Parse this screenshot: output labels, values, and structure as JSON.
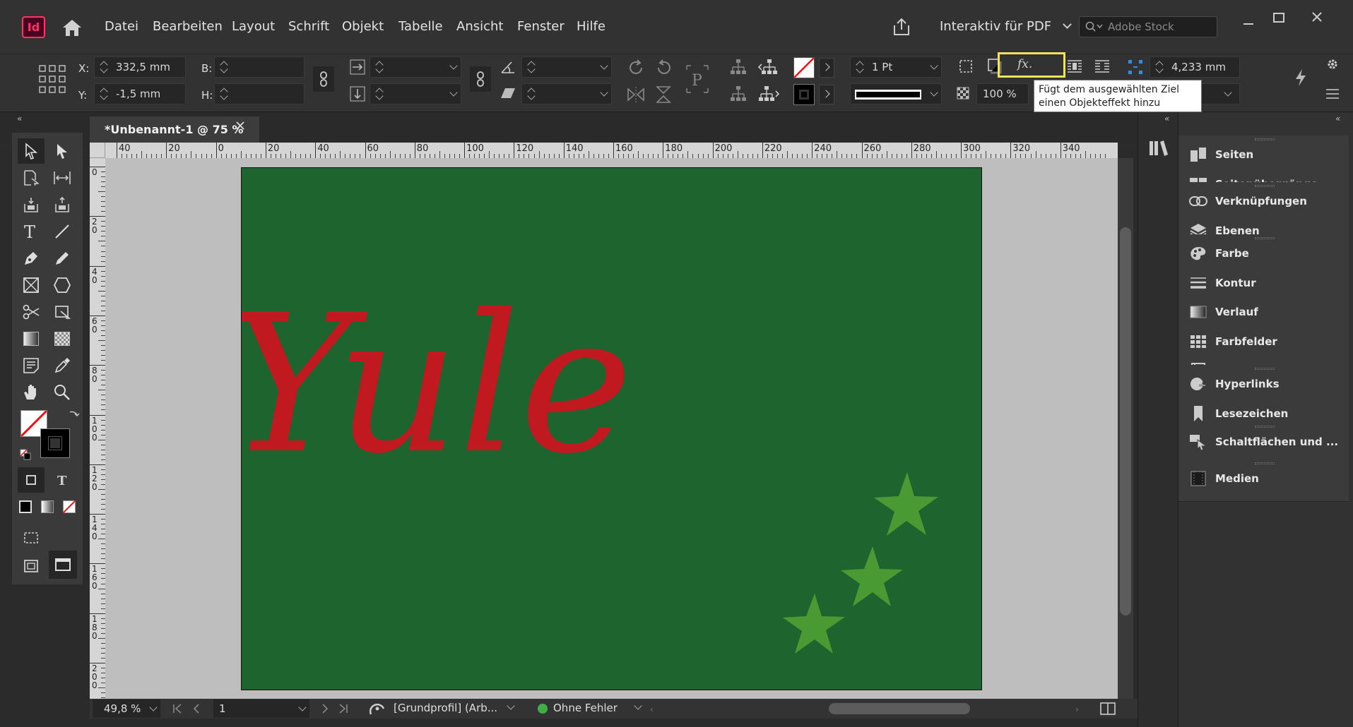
{
  "app": {
    "logo": "Id",
    "icon": "indesign-logo"
  },
  "menubar": {
    "items": [
      "Datei",
      "Bearbeiten",
      "Layout",
      "Schrift",
      "Objekt",
      "Tabelle",
      "Ansicht",
      "Fenster",
      "Hilfe"
    ],
    "workspace": "Interaktiv für PDF",
    "search_placeholder": "Adobe Stock"
  },
  "control": {
    "x_label": "X:",
    "x_value": "332,5 mm",
    "y_label": "Y:",
    "y_value": "-1,5 mm",
    "w_label": "B:",
    "h_label": "H:",
    "stroke_weight": "1 Pt",
    "opacity": "100 %",
    "gap_value": "4,233 mm",
    "fx_label": "fx.",
    "tooltip": "Fügt dem ausgewählten Ziel einen Objekteffekt hinzu"
  },
  "document": {
    "tab_title": "*Unbenannt-1 @ 75 %",
    "text": "Yule",
    "text_color": "#c0191f",
    "page_color": "#1e642f",
    "star_color": "#4a9a33",
    "ruler_h": [
      "40",
      "20",
      "0",
      "20",
      "40",
      "60",
      "80",
      "100",
      "120",
      "140",
      "160",
      "180",
      "200",
      "220",
      "240",
      "260",
      "280",
      "300",
      "320",
      "340"
    ],
    "ruler_v": [
      "0",
      "20",
      "40",
      "60",
      "80",
      "100",
      "120",
      "140",
      "160",
      "180",
      "200"
    ]
  },
  "status": {
    "zoom": "49,8 %",
    "page": "1",
    "profile": "[Grundprofil] (Arb...",
    "errors": "Ohne Fehler",
    "error_color": "#3fae49"
  },
  "panels": {
    "groups": [
      [
        "Seiten",
        "Seitenübergänge"
      ],
      [
        "Verknüpfungen",
        "Ebenen"
      ],
      [
        "Farbe",
        "Kontur",
        "Verlauf",
        "Farbfelder",
        "CC Libraries"
      ],
      [
        "Hyperlinks",
        "Lesezeichen"
      ],
      [
        "Schaltflächen und ..."
      ],
      [
        "Medien"
      ]
    ]
  }
}
